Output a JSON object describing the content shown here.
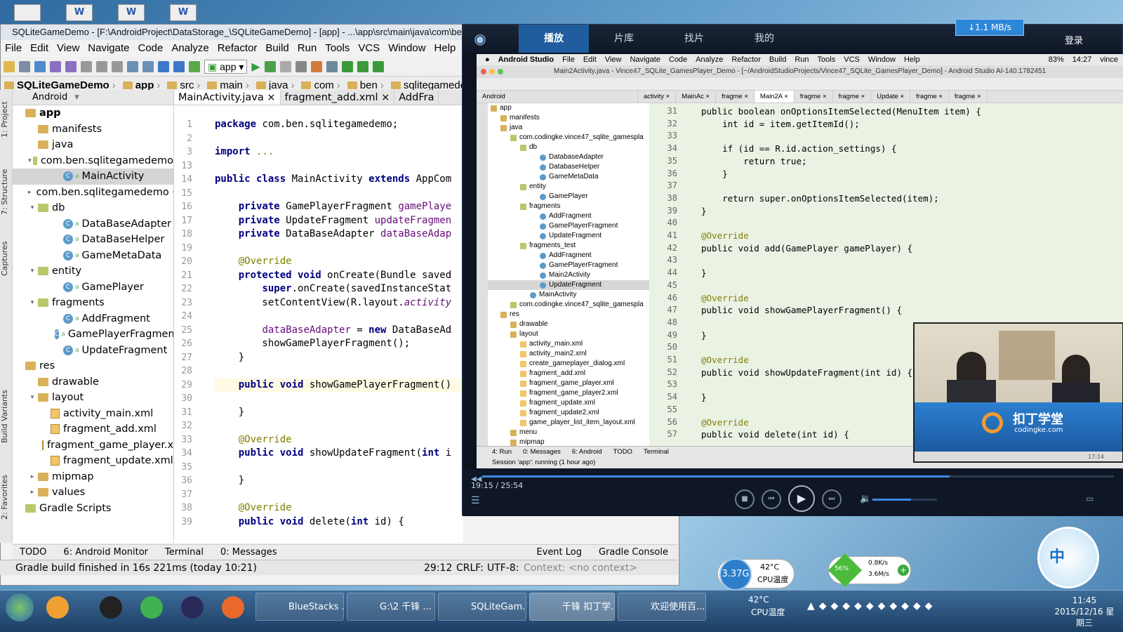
{
  "as": {
    "title": "SQLiteGameDemo - [F:\\AndroidProject\\DataStorage_\\SQLiteGameDemo] - [app] - ...\\app\\src\\main\\java\\com\\ben",
    "menu": [
      "File",
      "Edit",
      "View",
      "Navigate",
      "Code",
      "Analyze",
      "Refactor",
      "Build",
      "Run",
      "Tools",
      "VCS",
      "Window",
      "Help"
    ],
    "run_config": "app",
    "breadcrumb": [
      "SQLiteGameDemo",
      "app",
      "src",
      "main",
      "java",
      "com",
      "ben",
      "sqlitegamedemo"
    ],
    "project_view": "Android",
    "left_tabs": [
      "1: Project",
      "7: Structure",
      "Captures",
      "Build Variants",
      "2: Favorites"
    ],
    "tree": [
      {
        "label": "app",
        "kind": "folder",
        "indent": 0,
        "bold": true
      },
      {
        "label": "manifests",
        "kind": "folder",
        "indent": 1
      },
      {
        "label": "java",
        "kind": "folder",
        "indent": 1
      },
      {
        "label": "com.ben.sqlitegamedemo",
        "kind": "package",
        "indent": 1,
        "arrow": "▾"
      },
      {
        "label": "MainActivity",
        "kind": "class",
        "indent": 3,
        "sel": true
      },
      {
        "label": "com.ben.sqlitegamedemo (",
        "kind": "package",
        "indent": 1,
        "arrow": "▸"
      },
      {
        "label": "db",
        "kind": "package",
        "indent": 1,
        "arrow": "▾"
      },
      {
        "label": "DataBaseAdapter",
        "kind": "class",
        "indent": 3
      },
      {
        "label": "DataBaseHelper",
        "kind": "class",
        "indent": 3
      },
      {
        "label": "GameMetaData",
        "kind": "class",
        "indent": 3
      },
      {
        "label": "entity",
        "kind": "package",
        "indent": 1,
        "arrow": "▾"
      },
      {
        "label": "GamePlayer",
        "kind": "class",
        "indent": 3
      },
      {
        "label": "fragments",
        "kind": "package",
        "indent": 1,
        "arrow": "▾"
      },
      {
        "label": "AddFragment",
        "kind": "class",
        "indent": 3
      },
      {
        "label": "GamePlayerFragment",
        "kind": "class",
        "indent": 3
      },
      {
        "label": "UpdateFragment",
        "kind": "class",
        "indent": 3
      },
      {
        "label": "res",
        "kind": "folder",
        "indent": 0
      },
      {
        "label": "drawable",
        "kind": "folder",
        "indent": 1
      },
      {
        "label": "layout",
        "kind": "folder",
        "indent": 1,
        "arrow": "▾"
      },
      {
        "label": "activity_main.xml",
        "kind": "xml",
        "indent": 2
      },
      {
        "label": "fragment_add.xml",
        "kind": "xml",
        "indent": 2
      },
      {
        "label": "fragment_game_player.x",
        "kind": "xml",
        "indent": 2
      },
      {
        "label": "fragment_update.xml",
        "kind": "xml",
        "indent": 2
      },
      {
        "label": "mipmap",
        "kind": "folder",
        "indent": 1,
        "arrow": "▸"
      },
      {
        "label": "values",
        "kind": "folder",
        "indent": 1,
        "arrow": "▸"
      },
      {
        "label": "Gradle Scripts",
        "kind": "gradle",
        "indent": 0
      }
    ],
    "editor_tabs": [
      "MainActivity.java",
      "fragment_add.xml",
      "AddFra"
    ],
    "line_numbers": [
      "1",
      "2",
      "3",
      "13",
      "14",
      "15",
      "16",
      "17",
      "18",
      "19",
      "20",
      "21",
      "22",
      "23",
      "24",
      "25",
      "26",
      "27",
      "28",
      "29",
      "30",
      "31",
      "32",
      "33",
      "34",
      "35",
      "36",
      "37",
      "38",
      "39"
    ],
    "code": [
      [
        [
          "kw",
          "package "
        ],
        [
          "",
          "com.ben.sqlitegamedemo;"
        ]
      ],
      [
        [
          "",
          ""
        ]
      ],
      [
        [
          "kw",
          "import "
        ],
        [
          "an",
          "..."
        ]
      ],
      [
        [
          "",
          ""
        ]
      ],
      [
        [
          "kw",
          "public class "
        ],
        [
          "",
          "MainActivity "
        ],
        [
          "kw",
          "extends "
        ],
        [
          "",
          "AppCom"
        ]
      ],
      [
        [
          "",
          ""
        ]
      ],
      [
        [
          "",
          "    "
        ],
        [
          "kw",
          "private "
        ],
        [
          "",
          "GamePlayerFragment "
        ],
        [
          "fd",
          "gamePlaye"
        ]
      ],
      [
        [
          "",
          "    "
        ],
        [
          "kw",
          "private "
        ],
        [
          "",
          "UpdateFragment "
        ],
        [
          "fd",
          "updateFragmen"
        ]
      ],
      [
        [
          "",
          "    "
        ],
        [
          "kw",
          "private "
        ],
        [
          "",
          "DataBaseAdapter "
        ],
        [
          "fd",
          "dataBaseAdap"
        ]
      ],
      [
        [
          "",
          ""
        ]
      ],
      [
        [
          "",
          "    "
        ],
        [
          "an",
          "@Override"
        ]
      ],
      [
        [
          "",
          "    "
        ],
        [
          "kw",
          "protected void "
        ],
        [
          "",
          "onCreate(Bundle saved"
        ]
      ],
      [
        [
          "",
          "        "
        ],
        [
          "kw",
          "super"
        ],
        [
          "",
          ".onCreate(savedInstanceStat"
        ]
      ],
      [
        [
          "",
          "        setContentView(R.layout."
        ],
        [
          "it",
          "activity"
        ]
      ],
      [
        [
          "",
          ""
        ]
      ],
      [
        [
          "",
          "        "
        ],
        [
          "fd",
          "dataBaseAdapter"
        ],
        [
          "",
          " = "
        ],
        [
          "kw",
          "new "
        ],
        [
          "",
          "DataBaseAd"
        ]
      ],
      [
        [
          "",
          "        showGamePlayerFragment();"
        ]
      ],
      [
        [
          "",
          "    }"
        ]
      ],
      [
        [
          "",
          ""
        ]
      ],
      [
        [
          "",
          "    "
        ],
        [
          "kw",
          "public void "
        ],
        [
          "",
          "showGamePlayerFragment()"
        ]
      ],
      [
        [
          "",
          ""
        ]
      ],
      [
        [
          "",
          "    }"
        ]
      ],
      [
        [
          "",
          ""
        ]
      ],
      [
        [
          "",
          "    "
        ],
        [
          "an",
          "@Override"
        ]
      ],
      [
        [
          "",
          "    "
        ],
        [
          "kw",
          "public void "
        ],
        [
          "",
          "showUpdateFragment("
        ],
        [
          "kw",
          "int "
        ],
        [
          "",
          "i"
        ]
      ],
      [
        [
          "",
          ""
        ]
      ],
      [
        [
          "",
          "    }"
        ]
      ],
      [
        [
          "",
          ""
        ]
      ],
      [
        [
          "",
          "    "
        ],
        [
          "an",
          "@Override"
        ]
      ],
      [
        [
          "",
          "    "
        ],
        [
          "kw",
          "public void "
        ],
        [
          "",
          "delete("
        ],
        [
          "kw",
          "int "
        ],
        [
          "",
          "id) {"
        ]
      ]
    ],
    "bottom_tools": [
      "TODO",
      "6: Android Monitor",
      "Terminal",
      "0: Messages",
      "Event Log",
      "Gradle Console"
    ],
    "status": {
      "msg": "Gradle build finished in 16s 221ms (today 10:21)",
      "pos": "29:12",
      "crlf": "CRLF:",
      "enc": "UTF-8:",
      "ctx": "Context: <no context>"
    }
  },
  "player": {
    "tabs": [
      "播放",
      "片库",
      "找片",
      "我的"
    ],
    "speed": "↓1.1 MB/s",
    "login": "登录",
    "time": "19:15 / 25:54",
    "progress": 0.74,
    "volume": 0.6,
    "mac": {
      "menu": [
        "Android Studio",
        "File",
        "Edit",
        "View",
        "Navigate",
        "Code",
        "Analyze",
        "Refactor",
        "Build",
        "Run",
        "Tools",
        "VCS",
        "Window",
        "Help"
      ],
      "battery": "83%",
      "clock": "14:27",
      "user": "vince",
      "title": "Main2Activity.java - Vince47_SQLite_GamesPlayer_Demo - [~/AndroidStudioProjects/Vince47_SQLite_GamesPlayer_Demo] - Android Studio AI-140.1782451",
      "view": "Android",
      "tabs": [
        "activity",
        "MainAc",
        "fragme",
        "Main2A",
        "fragme",
        "fragme",
        "Update",
        "fragme",
        "fragme"
      ],
      "tree": [
        {
          "label": "app",
          "d": 0,
          "k": "f"
        },
        {
          "label": "manifests",
          "d": 1,
          "k": "f"
        },
        {
          "label": "java",
          "d": 1,
          "k": "f"
        },
        {
          "label": "com.codingke.vince47_sqlite_gamespla",
          "d": 2,
          "k": "p"
        },
        {
          "label": "db",
          "d": 3,
          "k": "p"
        },
        {
          "label": "DatabaseAdapter",
          "d": 5,
          "k": "c"
        },
        {
          "label": "DatabaseHelper",
          "d": 5,
          "k": "c"
        },
        {
          "label": "GameMetaData",
          "d": 5,
          "k": "c"
        },
        {
          "label": "entity",
          "d": 3,
          "k": "p"
        },
        {
          "label": "GamePlayer",
          "d": 5,
          "k": "c"
        },
        {
          "label": "fragments",
          "d": 3,
          "k": "p"
        },
        {
          "label": "AddFragment",
          "d": 5,
          "k": "c"
        },
        {
          "label": "GamePlayerFragment",
          "d": 5,
          "k": "c"
        },
        {
          "label": "UpdateFragment",
          "d": 5,
          "k": "c"
        },
        {
          "label": "fragments_test",
          "d": 3,
          "k": "p"
        },
        {
          "label": "AddFragment",
          "d": 5,
          "k": "c"
        },
        {
          "label": "GamePlayerFragment",
          "d": 5,
          "k": "c"
        },
        {
          "label": "Main2Activity",
          "d": 5,
          "k": "c"
        },
        {
          "label": "UpdateFragment",
          "d": 5,
          "k": "c",
          "sel": true
        },
        {
          "label": "MainActivity",
          "d": 4,
          "k": "c"
        },
        {
          "label": "com.codingke.vince47_sqlite_gamespla",
          "d": 2,
          "k": "p"
        },
        {
          "label": "res",
          "d": 1,
          "k": "f"
        },
        {
          "label": "drawable",
          "d": 2,
          "k": "f"
        },
        {
          "label": "layout",
          "d": 2,
          "k": "f"
        },
        {
          "label": "activity_main.xml",
          "d": 3,
          "k": "x"
        },
        {
          "label": "activity_main2.xml",
          "d": 3,
          "k": "x"
        },
        {
          "label": "create_gameplayer_dialog.xml",
          "d": 3,
          "k": "x"
        },
        {
          "label": "fragment_add.xml",
          "d": 3,
          "k": "x"
        },
        {
          "label": "fragment_game_player.xml",
          "d": 3,
          "k": "x"
        },
        {
          "label": "fragment_game_player2.xml",
          "d": 3,
          "k": "x"
        },
        {
          "label": "fragment_update.xml",
          "d": 3,
          "k": "x"
        },
        {
          "label": "fragment_update2.xml",
          "d": 3,
          "k": "x"
        },
        {
          "label": "game_player_list_item_layout.xml",
          "d": 3,
          "k": "x"
        },
        {
          "label": "menu",
          "d": 2,
          "k": "f"
        },
        {
          "label": "mipmap",
          "d": 2,
          "k": "f"
        }
      ],
      "lines": [
        "31",
        "32",
        "33",
        "34",
        "35",
        "36",
        "37",
        "38",
        "39",
        "40",
        "41",
        "42",
        "43",
        "44",
        "45",
        "46",
        "47",
        "48",
        "49",
        "50",
        "51",
        "52",
        "53",
        "54",
        "55",
        "56",
        "57"
      ],
      "code": [
        "public boolean onOptionsItemSelected(MenuItem item) {",
        "    int id = item.getItemId();",
        "",
        "    if (id == R.id.action_settings) {",
        "        return true;",
        "    }",
        "",
        "    return super.onOptionsItemSelected(item);",
        "}",
        "",
        "@Override",
        "public void add(GamePlayer gamePlayer) {",
        "",
        "}",
        "",
        "@Override",
        "public void showGamePlayerFragment() {",
        "",
        "}",
        "",
        "@Override",
        "public void showUpdateFragment(int id) {",
        "",
        "}",
        "",
        "@Override",
        "public void delete(int id) {"
      ],
      "bottom": [
        "4: Run",
        "0: Messages",
        "6: Android",
        "TODO",
        "Terminal"
      ],
      "session": "Session 'app': running (1 hour ago)"
    },
    "cam_logo": "扣丁学堂",
    "cam_sub": "codingke.com",
    "cam_time": "17:14"
  },
  "widgets": {
    "cpu_ghz": "3.37G",
    "cpu_temp": "42°C",
    "cpu_label": "CPU温度",
    "net_pct": "56%",
    "up": "0.8K/s",
    "down": "3.6M/s"
  },
  "taskbar": {
    "buttons": [
      "BlueStacks ...",
      "G:\\2 千锋 ...",
      "SQLiteGam...",
      "千锋 扣丁学...",
      "欢迎使用百..."
    ],
    "temp": "42°C",
    "temp_label": "CPU温度",
    "time": "11:45",
    "date": "2015/12/16 星期三"
  }
}
